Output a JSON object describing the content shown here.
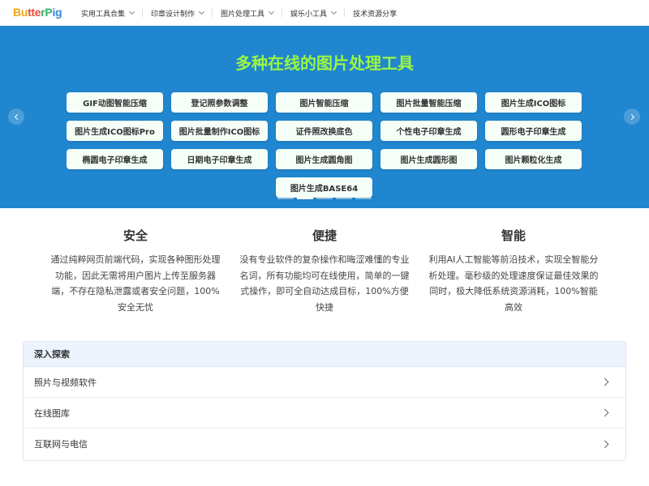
{
  "header": {
    "logo": "ButterPig",
    "nav": [
      {
        "label": "实用工具合集",
        "has_menu": true
      },
      {
        "label": "印章设计制作",
        "has_menu": true
      },
      {
        "label": "图片处理工具",
        "has_menu": true
      },
      {
        "label": "娱乐小工具",
        "has_menu": true
      },
      {
        "label": "技术资源分享",
        "has_menu": false
      }
    ]
  },
  "banner": {
    "title": "多种在线的图片处理工具",
    "tools": [
      "GIF动图智能压缩",
      "登记照参数调整",
      "图片智能压缩",
      "图片批量智能压缩",
      "图片生成ICO图标",
      "图片生成ICO图标Pro",
      "图片批量制作ICO图标",
      "证件照改换底色",
      "个性电子印章生成",
      "圆形电子印章生成",
      "椭圆电子印章生成",
      "日期电子印章生成",
      "图片生成圆角图",
      "图片生成圆形图",
      "图片颗粒化生成",
      "图片生成BASE64"
    ],
    "slides": 5,
    "active_slide": 1,
    "colors": {
      "background": "#1f86cf",
      "title": "#9ef542"
    }
  },
  "features": [
    {
      "title": "安全",
      "desc": "通过纯粹网页前端代码，实现各种图形处理功能，因此无需将用户图片上传至服务器端，不存在隐私泄露或者安全问题，100%安全无忧"
    },
    {
      "title": "便捷",
      "desc": "没有专业软件的复杂操作和晦涩难懂的专业名词，所有功能均可在线使用，简单的一键式操作，即可全自动达成目标，100%方便快捷"
    },
    {
      "title": "智能",
      "desc": "利用AI人工智能等前沿技术，实现全智能分析处理。毫秒级的处理速度保证最佳效果的同时，极大降低系统资源消耗，100%智能高效"
    }
  ],
  "explore": {
    "title": "深入探索",
    "items": [
      "照片与视频软件",
      "在线图库",
      "互联网与电信"
    ]
  }
}
